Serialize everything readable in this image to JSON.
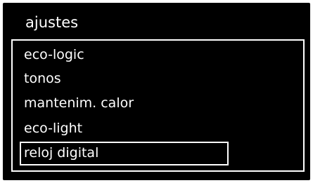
{
  "screen": {
    "title": "ajustes",
    "menu": {
      "items": [
        {
          "label": "eco-logic"
        },
        {
          "label": "tonos"
        },
        {
          "label": "mantenim. calor"
        },
        {
          "label": "eco-light"
        },
        {
          "label": "reloj digital"
        }
      ],
      "selected_index": 4
    }
  }
}
